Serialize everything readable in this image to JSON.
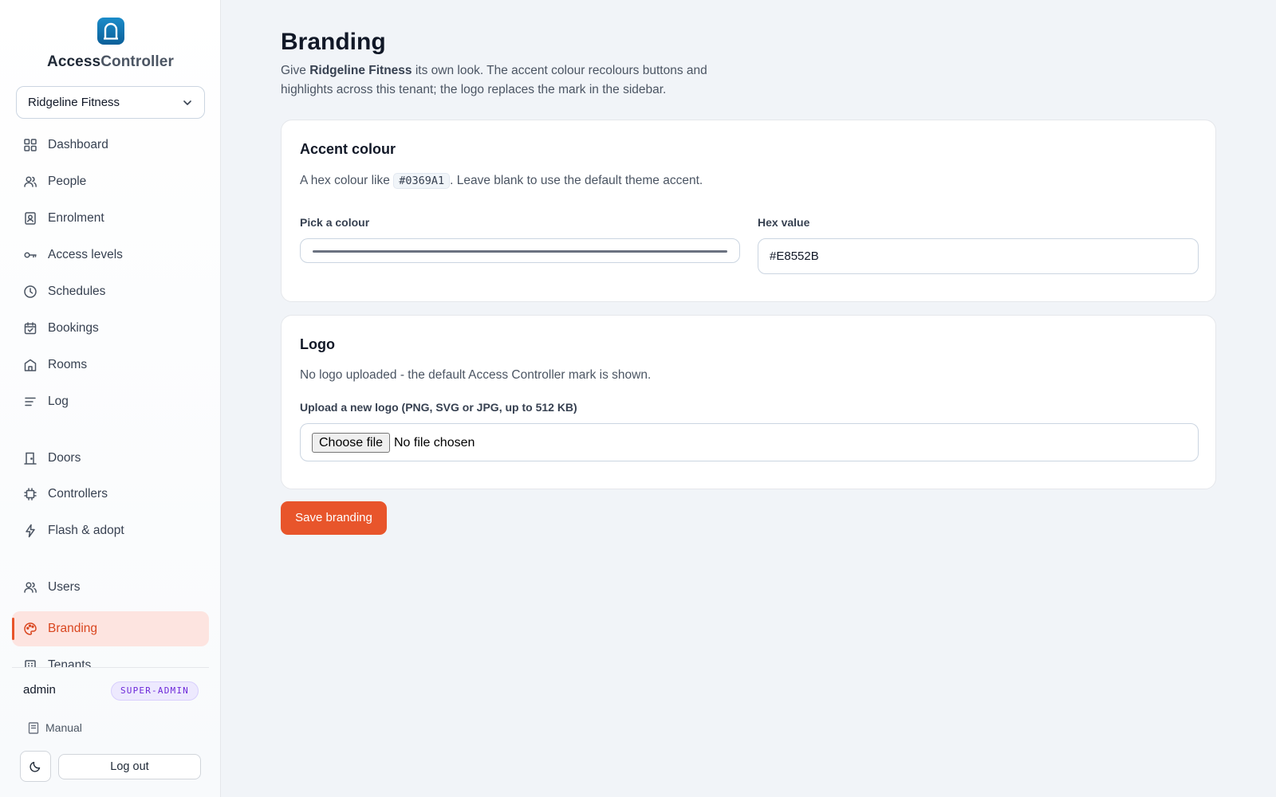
{
  "brand": {
    "name_part1": "Access",
    "name_part2": "Controller"
  },
  "tenant_select": {
    "value": "Ridgeline Fitness"
  },
  "sidebar": {
    "items": [
      {
        "label": "Dashboard",
        "icon": "grid-icon"
      },
      {
        "label": "People",
        "icon": "people-icon"
      },
      {
        "label": "Enrolment",
        "icon": "badge-icon"
      },
      {
        "label": "Access levels",
        "icon": "key-icon"
      },
      {
        "label": "Schedules",
        "icon": "clock-icon"
      },
      {
        "label": "Bookings",
        "icon": "calendar-check-icon"
      },
      {
        "label": "Rooms",
        "icon": "room-icon"
      },
      {
        "label": "Log",
        "icon": "list-icon"
      },
      {
        "label": "Doors",
        "icon": "door-icon"
      },
      {
        "label": "Controllers",
        "icon": "chip-icon"
      },
      {
        "label": "Flash & adopt",
        "icon": "lightning-icon"
      },
      {
        "label": "Users",
        "icon": "users-icon"
      },
      {
        "label": "Branding",
        "icon": "palette-icon",
        "active": true
      },
      {
        "label": "Tenants",
        "icon": "building-icon"
      }
    ]
  },
  "user": {
    "name": "admin",
    "role": "SUPER-ADMIN"
  },
  "footer": {
    "manual_label": "Manual",
    "logout_label": "Log out"
  },
  "page": {
    "title": "Branding",
    "desc_prefix": "Give ",
    "desc_tenant": "Ridgeline Fitness",
    "desc_suffix": " its own look. The accent colour recolours buttons and highlights across this tenant; the logo replaces the mark in the sidebar."
  },
  "accent_card": {
    "title": "Accent colour",
    "desc_prefix": "A hex colour like ",
    "desc_example": "#0369A1",
    "desc_suffix": ". Leave blank to use the default theme accent.",
    "pick_label": "Pick a colour",
    "hex_label": "Hex value",
    "hex_value": "#E8552B"
  },
  "logo_card": {
    "title": "Logo",
    "desc": "No logo uploaded - the default Access Controller mark is shown.",
    "upload_label": "Upload a new logo (PNG, SVG or JPG, up to 512 KB)",
    "file_button": "Choose file",
    "file_status": "No file chosen"
  },
  "actions": {
    "save_label": "Save branding"
  },
  "colors": {
    "accent": "#E8552B",
    "brand_blue": "#0B5F99",
    "role_purple": "#6D28D9"
  }
}
